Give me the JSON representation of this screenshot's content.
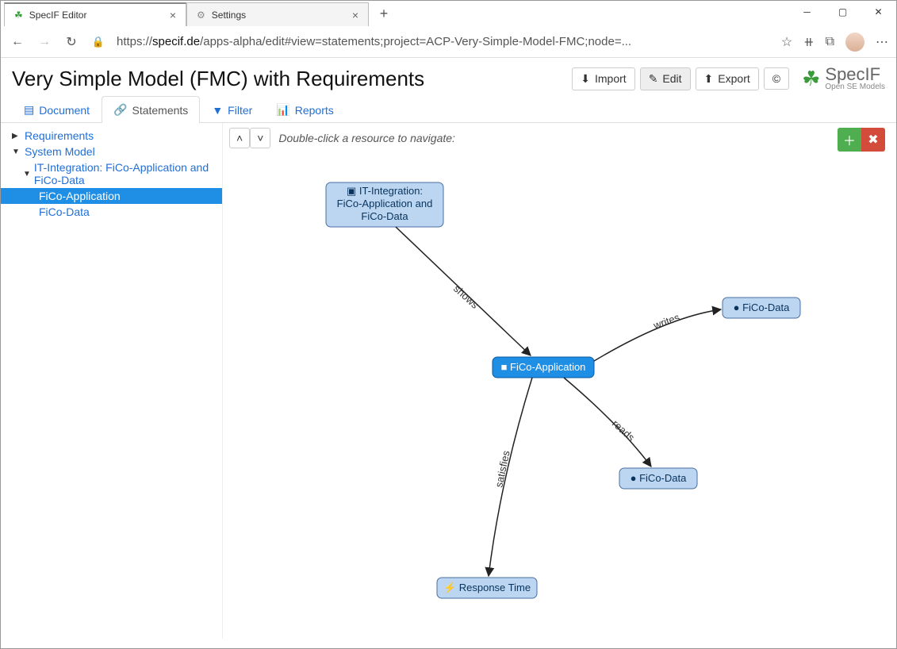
{
  "browser": {
    "tabs": [
      {
        "title": "SpecIF Editor",
        "active": true
      },
      {
        "title": "Settings",
        "active": false
      }
    ],
    "url_prefix": "https://",
    "url_host": "specif.de",
    "url_path": "/apps-alpha/edit#view=statements;project=ACP-Very-Simple-Model-FMC;node=..."
  },
  "page": {
    "title": "Very Simple Model (FMC) with Requirements"
  },
  "toolbar": {
    "import": "Import",
    "edit": "Edit",
    "export": "Export",
    "about": "©"
  },
  "brand": {
    "name": "SpecIF",
    "sub": "Open SE Models"
  },
  "viewtabs": {
    "document": "Document",
    "statements": "Statements",
    "filter": "Filter",
    "reports": "Reports"
  },
  "tree": {
    "root1": "Requirements",
    "root2": "System Model",
    "sub1": "IT-Integration: FiCo-Application and FiCo-Data",
    "leaf1": "FiCo-Application",
    "leaf2": "FiCo-Data"
  },
  "canvas": {
    "hint": "Double-click a resource to navigate:"
  },
  "graph": {
    "nodes": {
      "it_integration": "▣ IT-Integration:\nFiCo-Application and\nFiCo-Data",
      "it_l1": "▣ IT-Integration:",
      "it_l2": "FiCo-Application and",
      "it_l3": "FiCo-Data",
      "fico_app": "■ FiCo-Application",
      "fico_data1": "● FiCo-Data",
      "fico_data2": "● FiCo-Data",
      "response": "⚡ Response Time"
    },
    "edges": {
      "shows": "shows",
      "writes": "writes",
      "reads": "reads",
      "satisfies": "satisfies"
    }
  }
}
